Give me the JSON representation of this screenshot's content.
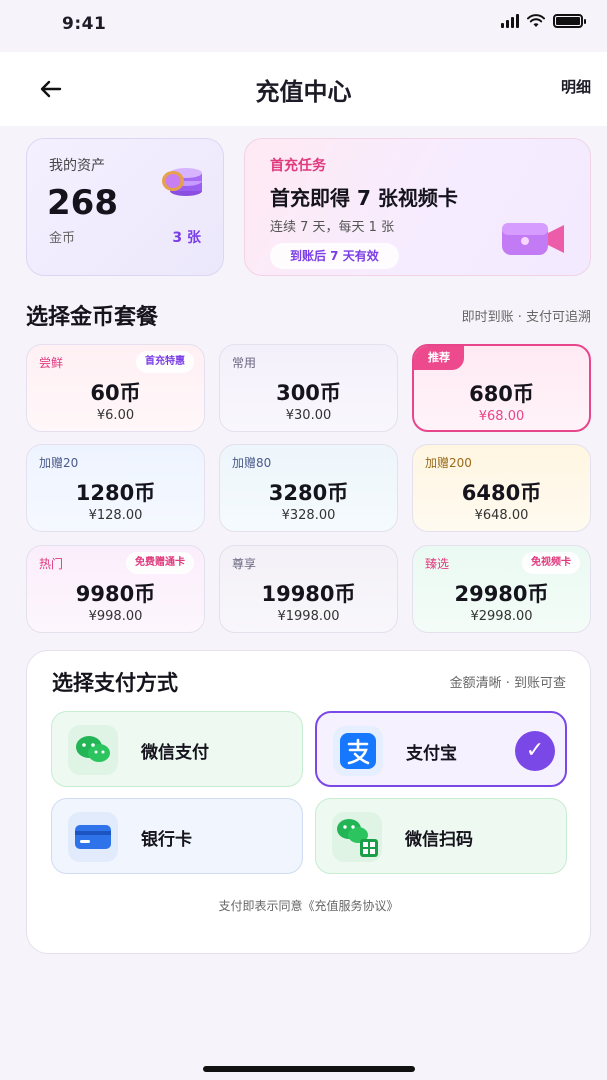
{
  "status_bar": {
    "time": "9:41"
  },
  "nav": {
    "title": "充值中心",
    "detail": "明细"
  },
  "asset": {
    "label": "我的资产",
    "value": "268",
    "unit": "金币",
    "count": "3 张"
  },
  "task": {
    "tag": "首充任务",
    "title": "首充即得 7 张视频卡",
    "subtitle": "连续 7 天，每天 1 张",
    "pill": "到账后 7 天有效"
  },
  "packages_section": {
    "title": "选择金币套餐",
    "note": "即时到账 · 支付可追溯"
  },
  "packages": [
    {
      "tag": "尝鲜",
      "badge": "首充特惠",
      "coins": "60币",
      "price": "¥6.00"
    },
    {
      "tag": "常用",
      "badge": "",
      "coins": "300币",
      "price": "¥30.00"
    },
    {
      "tag": "推荐",
      "badge": "",
      "coins": "680币",
      "price": "¥68.00"
    },
    {
      "tag": "加赠20",
      "badge": "",
      "coins": "1280币",
      "price": "¥128.00"
    },
    {
      "tag": "加赠80",
      "badge": "",
      "coins": "3280币",
      "price": "¥328.00"
    },
    {
      "tag": "加赠200",
      "badge": "",
      "coins": "6480币",
      "price": "¥648.00"
    },
    {
      "tag": "热门",
      "badge": "免费赠通卡",
      "coins": "9980币",
      "price": "¥998.00"
    },
    {
      "tag": "尊享",
      "badge": "",
      "coins": "19980币",
      "price": "¥1998.00"
    },
    {
      "tag": "臻选",
      "badge": "免视频卡",
      "coins": "29980币",
      "price": "¥2998.00"
    }
  ],
  "payment": {
    "title": "选择支付方式",
    "note": "金额清晰 · 到账可查",
    "options": [
      {
        "label": "微信支付",
        "icon": "wechat-icon"
      },
      {
        "label": "支付宝",
        "icon": "alipay-icon",
        "selected": true
      },
      {
        "label": "银行卡",
        "icon": "bank-card-icon"
      },
      {
        "label": "微信扫码",
        "icon": "wechat-scan-icon"
      }
    ],
    "check_mark": "✓",
    "agreement": "支付即表示同意《充值服务协议》"
  },
  "colors": {
    "accent_purple": "#7a48e6",
    "accent_pink": "#e8468c",
    "wechat_green": "#22b455",
    "alipay_blue": "#1677ff"
  }
}
